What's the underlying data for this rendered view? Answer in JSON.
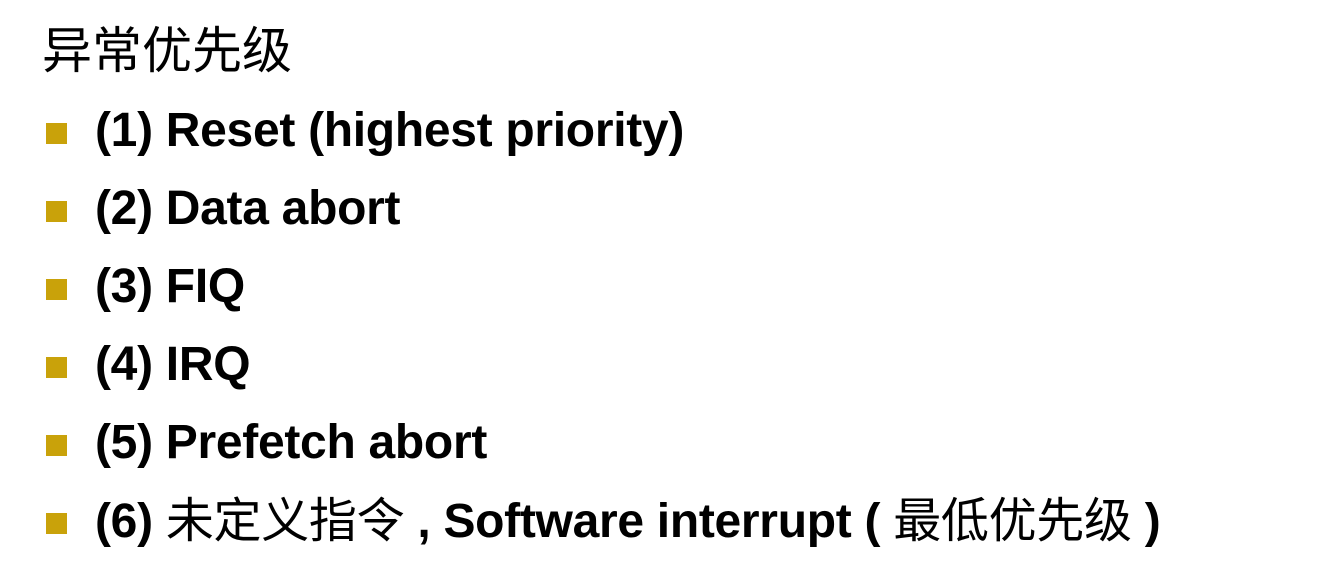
{
  "heading": "异常优先级",
  "colors": {
    "bullet": "#c9a20a",
    "text": "#000000",
    "background": "#ffffff"
  },
  "bullets": [
    {
      "parts": [
        {
          "text": "(1) Reset (highest priority)"
        }
      ]
    },
    {
      "parts": [
        {
          "text": "(2) Data abort"
        }
      ]
    },
    {
      "parts": [
        {
          "text": "(3) FIQ"
        }
      ]
    },
    {
      "parts": [
        {
          "text": "(4) IRQ"
        }
      ]
    },
    {
      "parts": [
        {
          "text": "(5) Prefetch abort"
        }
      ]
    },
    {
      "parts": [
        {
          "text": "(6) "
        },
        {
          "text": "未定义指令",
          "cjk": true
        },
        {
          "text": ", Software interrupt ("
        },
        {
          "text": "最低优先级",
          "cjk": true
        },
        {
          "text": ")"
        }
      ]
    }
  ]
}
